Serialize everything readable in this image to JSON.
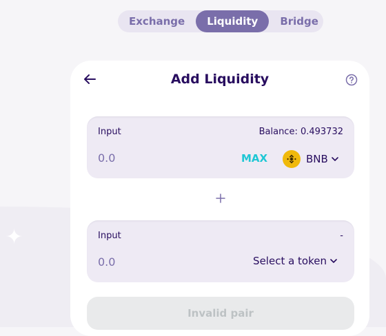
{
  "nav": {
    "tabs": [
      "Exchange",
      "Liquidity",
      "Bridge"
    ],
    "active": "Liquidity"
  },
  "card": {
    "title": "Add Liquidity",
    "input_a": {
      "label": "Input",
      "balance": "Balance: 0.493732",
      "value": "",
      "placeholder": "0.0",
      "max_label": "MAX",
      "token": "BNB"
    },
    "input_b": {
      "label": "Input",
      "balance": "-",
      "value": "",
      "placeholder": "0.0",
      "select_label": "Select a token"
    },
    "submit_label": "Invalid pair"
  },
  "icons": {
    "back": "arrow-left-icon",
    "help": "help-circle-icon",
    "plus": "plus-icon",
    "token": "bnb-logo-icon",
    "dropdown": "chevron-down-icon"
  },
  "colors": {
    "accent": "#7a6eaa",
    "text": "#280d5f",
    "max": "#1fc7d4",
    "bnb": "#f0b90b"
  }
}
